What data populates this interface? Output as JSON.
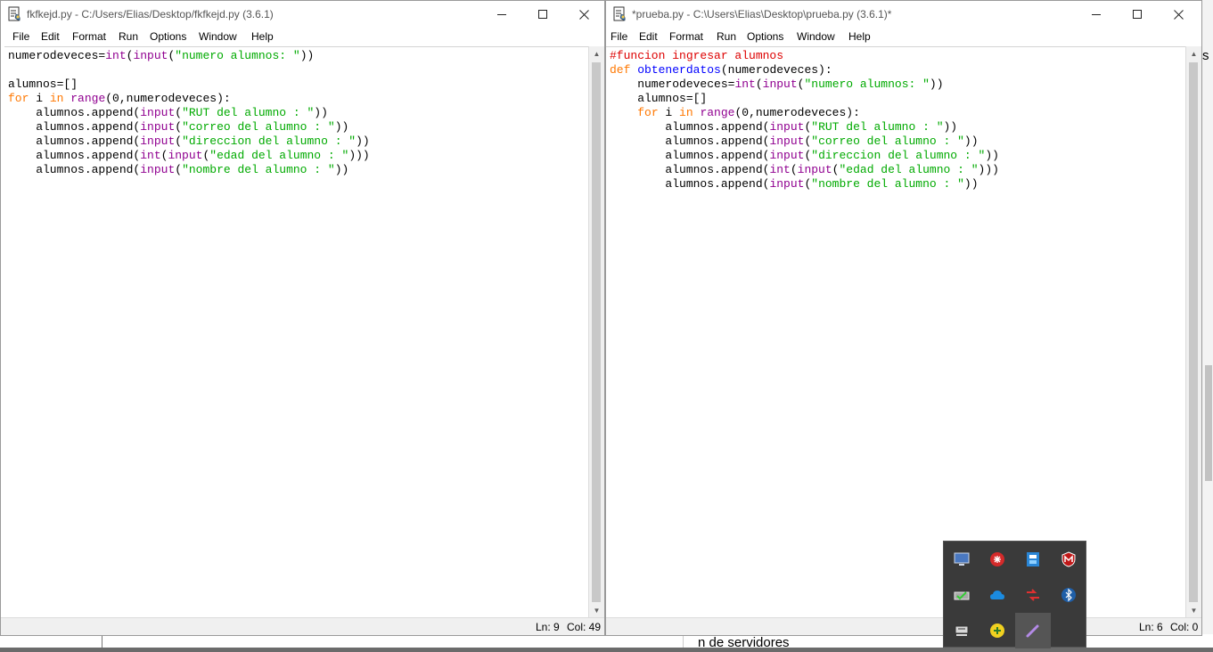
{
  "left_window": {
    "title": "fkfkejd.py - C:/Users/Elias/Desktop/fkfkejd.py (3.6.1)",
    "menu": [
      "File",
      "Edit",
      "Format",
      "Run",
      "Options",
      "Window",
      "Help"
    ],
    "code_lines": [
      "numerodeveces=int(input(\"numero alumnos: \"))",
      "",
      "alumnos=[]",
      "for i in range(0,numerodeveces):",
      "    alumnos.append(input(\"RUT del alumno : \"))",
      "    alumnos.append(input(\"correo del alumno : \"))",
      "    alumnos.append(input(\"direccion del alumno : \"))",
      "    alumnos.append(int(input(\"edad del alumno : \")))",
      "    alumnos.append(input(\"nombre del alumno : \"))"
    ],
    "status_ln": "Ln: 9",
    "status_col": "Col: 49"
  },
  "right_window": {
    "title": "*prueba.py - C:\\Users\\Elias\\Desktop\\prueba.py (3.6.1)*",
    "menu": [
      "File",
      "Edit",
      "Format",
      "Run",
      "Options",
      "Window",
      "Help"
    ],
    "code_lines": [
      "#funcion ingresar alumnos",
      "def obtenerdatos(numerodeveces):",
      "    numerodeveces=int(input(\"numero alumnos: \"))",
      "    alumnos=[]",
      "    for i in range(0,numerodeveces):",
      "        alumnos.append(input(\"RUT del alumno : \"))",
      "        alumnos.append(input(\"correo del alumno : \"))",
      "        alumnos.append(input(\"direccion del alumno : \"))",
      "        alumnos.append(int(input(\"edad del alumno : \")))",
      "        alumnos.append(input(\"nombre del alumno : \"))"
    ],
    "status_ln": "Ln: 6",
    "status_col": "Col: 0"
  },
  "syntax_colors": {
    "keyword": "#ff7700",
    "builtin": "#900090",
    "string": "#00aa00",
    "comment": "#dd0000",
    "definition": "#0000ff"
  },
  "background_text": "n de servidores",
  "background_side_text": "s",
  "tray_icons": [
    "display-icon",
    "antivirus-icon",
    "network-drive-icon",
    "mcafee-shield-icon",
    "usb-device-icon",
    "onedrive-cloud-icon",
    "network-adapter-icon",
    "bluetooth-icon",
    "safely-remove-hardware-icon",
    "update-badge-icon",
    "pen-icon"
  ]
}
